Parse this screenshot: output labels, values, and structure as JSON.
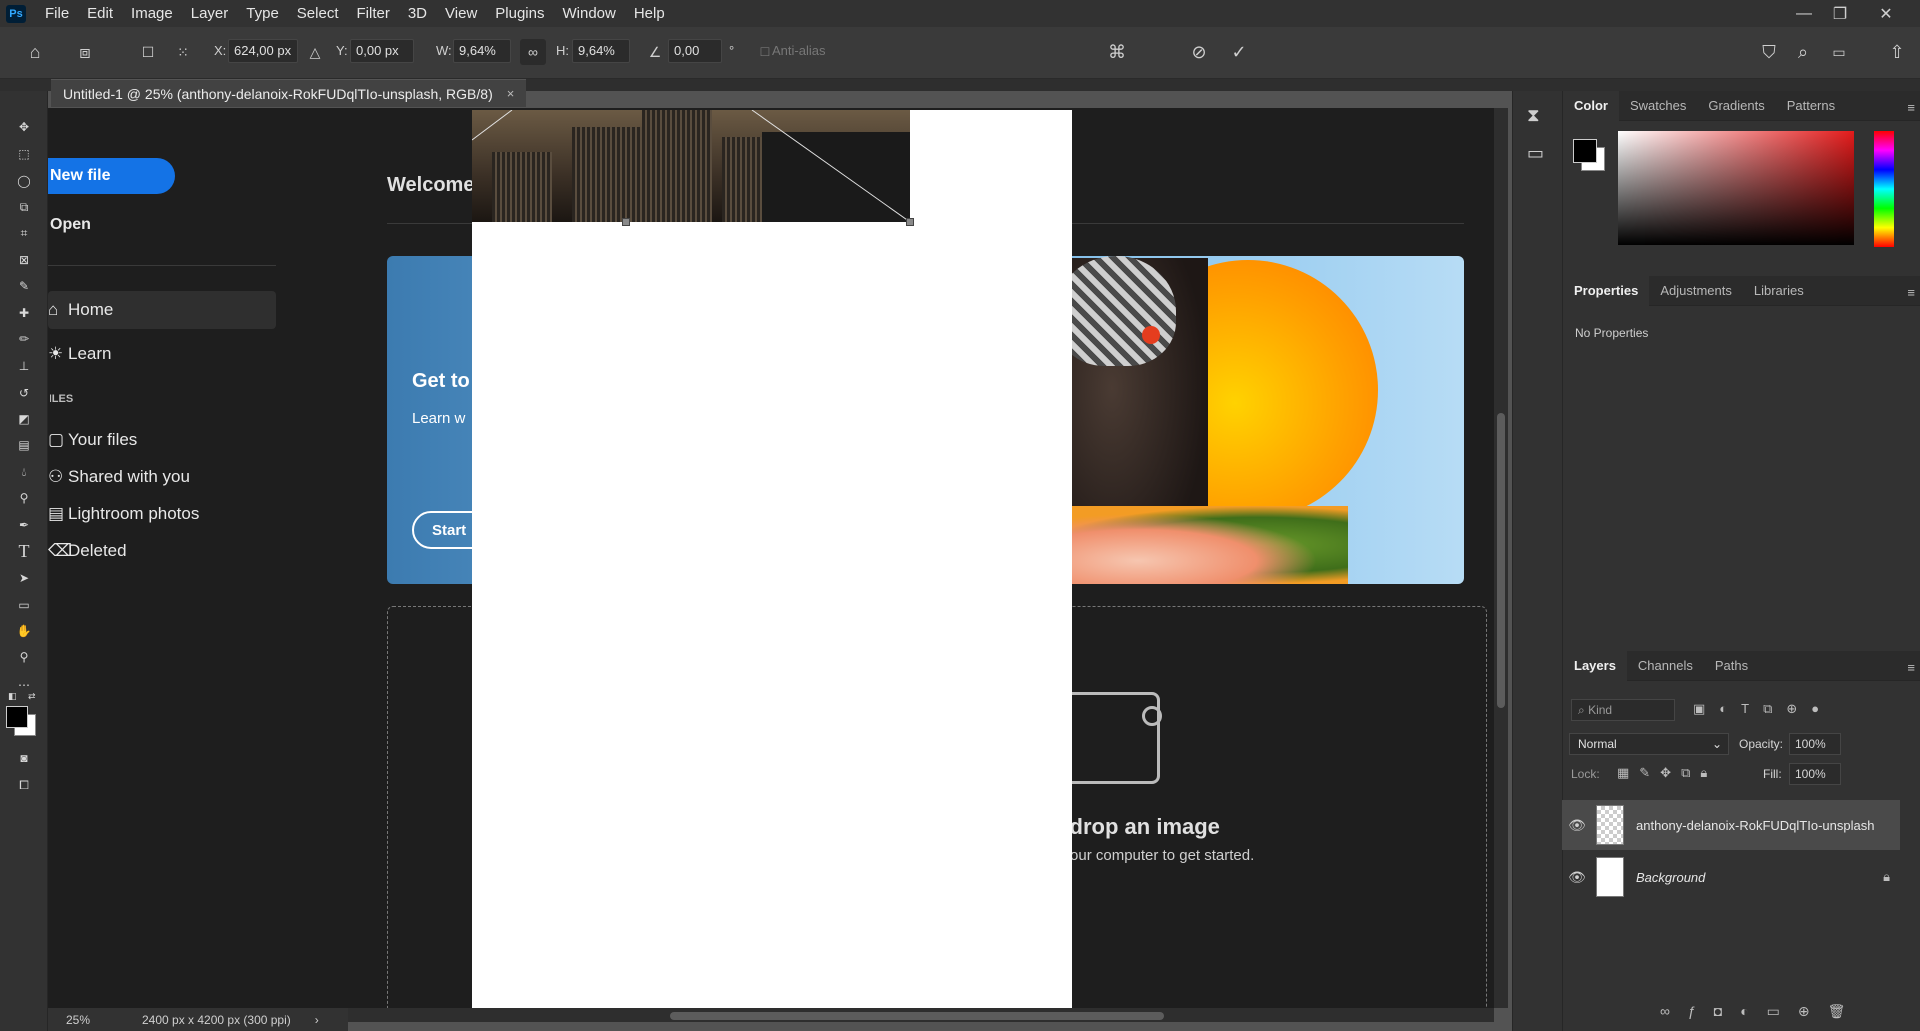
{
  "app": {
    "logo": "Ps"
  },
  "menu": [
    "File",
    "Edit",
    "Image",
    "Layer",
    "Type",
    "Select",
    "Filter",
    "3D",
    "View",
    "Plugins",
    "Window",
    "Help"
  ],
  "options": {
    "x_label": "X:",
    "x_value": "624,00 px",
    "y_label": "Y:",
    "y_value": "0,00 px",
    "w_label": "W:",
    "w_value": "9,64%",
    "h_label": "H:",
    "h_value": "9,64%",
    "angle_value": "0,00",
    "angle_unit": "°",
    "antialias_label": "Anti-alias"
  },
  "document_tab": {
    "title": "Untitled-1 @ 25% (anthony-delanoix-RokFUDqlTIo-unsplash, RGB/8)",
    "close": "×"
  },
  "home": {
    "new_file": "New file",
    "open": "Open",
    "nav": [
      "Home",
      "Learn"
    ],
    "files_header": "FILES",
    "files": [
      "Your files",
      "Shared with you",
      "Lightroom photos",
      "Deleted"
    ],
    "welcome": "Welcome",
    "banner_title": "Get to",
    "banner_sub": "Learn w",
    "banner_btn": "Start",
    "drop_title": "d drop an image",
    "drop_sub": "n your computer to get started."
  },
  "status": {
    "zoom": "25%",
    "doc_info": "2400 px x 4200 px (300 ppi)"
  },
  "color_panel": {
    "tabs": [
      "Color",
      "Swatches",
      "Gradients",
      "Patterns"
    ]
  },
  "properties_panel": {
    "tabs": [
      "Properties",
      "Adjustments",
      "Libraries"
    ],
    "empty": "No Properties"
  },
  "layers_panel": {
    "tabs": [
      "Layers",
      "Channels",
      "Paths"
    ],
    "filter_placeholder": "Kind",
    "blend_mode": "Normal",
    "opacity_label": "Opacity:",
    "opacity_value": "100%",
    "lock_label": "Lock:",
    "fill_label": "Fill:",
    "fill_value": "100%",
    "layers": [
      {
        "name": "anthony-delanoix-RokFUDqlTIo-unsplash",
        "selected": true
      },
      {
        "name": "Background",
        "locked": true
      }
    ]
  },
  "colors": {
    "accent": "#1473e6",
    "foreground": "#000000",
    "background": "#ffffff"
  }
}
